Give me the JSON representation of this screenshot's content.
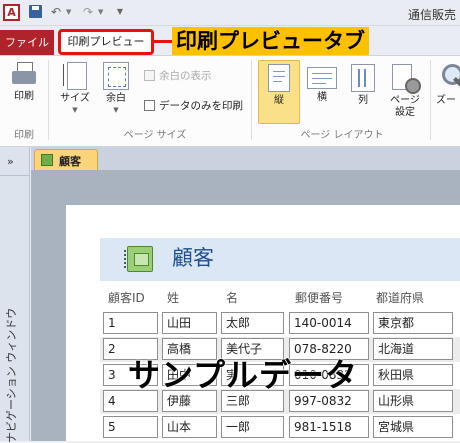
{
  "titlebar": {
    "app_icon": "A",
    "title": "通信販売"
  },
  "tabs": {
    "file": "ファイル",
    "print_preview": "印刷プレビュー"
  },
  "callout": "印刷プレビュータブ",
  "ribbon": {
    "print_group": {
      "print_label": "印刷",
      "group_label": "印刷"
    },
    "page_size_group": {
      "size_label": "サイズ",
      "margin_label": "余白",
      "show_margins_label": "余白の表示",
      "print_data_only_label": "データのみを印刷",
      "group_label": "ページ サイズ"
    },
    "page_layout_group": {
      "portrait_label": "縦",
      "landscape_label": "横",
      "columns_label": "列",
      "page_setup_label": "ページ\n設定",
      "group_label": "ページ レイアウト"
    },
    "zoom_label": "ズー"
  },
  "nav_pane": {
    "toggle": "»",
    "label": "ナビゲーション ウィンドウ"
  },
  "document_tab": "顧客",
  "report": {
    "title": "顧客",
    "columns": [
      "顧客ID",
      "姓",
      "名",
      "郵便番号",
      "都道府県"
    ],
    "rows": [
      [
        "1",
        "山田",
        "太郎",
        "140-0014",
        "東京都"
      ],
      [
        "2",
        "高橋",
        "美代子",
        "078-8220",
        "北海道"
      ],
      [
        "3",
        "田中",
        "実",
        "010-0832",
        "秋田県"
      ],
      [
        "4",
        "伊藤",
        "三郎",
        "997-0832",
        "山形県"
      ],
      [
        "5",
        "山本",
        "一郎",
        "981-1518",
        "宮城県"
      ]
    ]
  },
  "overlay_text": "サンプルデータ"
}
